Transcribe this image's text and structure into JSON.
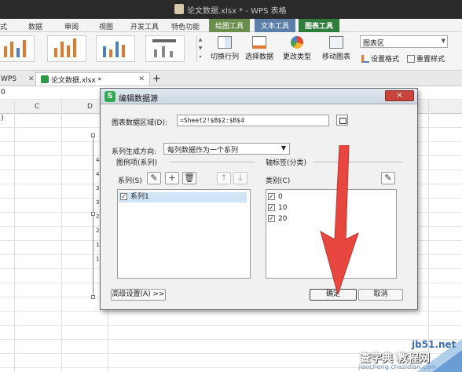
{
  "window": {
    "title": "论文数据.xlsx * - WPS 表格"
  },
  "ribbon_tabs": [
    {
      "label": "式"
    },
    {
      "label": "数据"
    },
    {
      "label": "审阅"
    },
    {
      "label": "视图"
    },
    {
      "label": "开发工具"
    },
    {
      "label": "特色功能"
    }
  ],
  "context_tabs": [
    {
      "label": "绘图工具"
    },
    {
      "label": "文本工具"
    },
    {
      "label": "图表工具"
    }
  ],
  "ribbon": {
    "switch_row_col": "切换行列",
    "select_data": "选择数据",
    "change_type": "更改类型",
    "move_chart": "移动图表",
    "chart_area": "图表区",
    "set_format": "设置格式",
    "reset_style": "重置样式"
  },
  "doc_tabs": {
    "wps": "WPS",
    "active": "论文数据.xlsx *",
    "new_tab": "+"
  },
  "namebox": "0",
  "grid": {
    "col_c": "C",
    "col_d": "D",
    "row1_text": ")",
    "chart_ticks": [
      "4",
      "4",
      "3",
      "3",
      "2",
      "2",
      "1",
      "1"
    ]
  },
  "dialog": {
    "title": "编辑数据源",
    "close_glyph": "×",
    "range_label": "图表数据区域(D):",
    "range_value": "=Sheet2!$B$2:$B$4",
    "orientation_label": "系列生成方向:",
    "orientation_value": "每列数据作为一个系列",
    "legend_group": "图例项(系列)",
    "series_label": "系列(S)",
    "series_items": [
      "系列1"
    ],
    "axis_group": "轴标签(分类)",
    "category_label": "类别(C)",
    "category_items": [
      "0",
      "10",
      "20"
    ],
    "advanced": "高级设置(A) >>",
    "ok": "确定",
    "cancel": "取消"
  },
  "watermark": {
    "site": "jb51.net",
    "text": "查字典 教程网",
    "url": "jiaocheng.chazidian.com"
  },
  "colors": {
    "accent_red": "#e8473f",
    "dialog_close": "#c9443b",
    "selection": "#cfe4f7"
  }
}
